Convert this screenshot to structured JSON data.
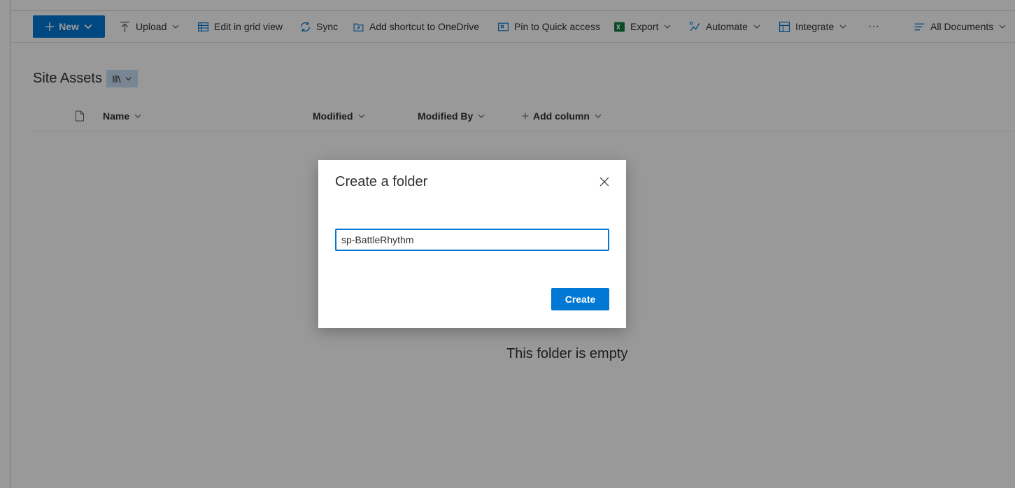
{
  "toolbar": {
    "new_label": "New",
    "upload_label": "Upload",
    "grid_label": "Edit in grid view",
    "sync_label": "Sync",
    "shortcut_label": "Add shortcut to OneDrive",
    "pin_label": "Pin to Quick access",
    "export_label": "Export",
    "automate_label": "Automate",
    "integrate_label": "Integrate",
    "more_label": "···",
    "view_label": "All Documents"
  },
  "library": {
    "title": "Site Assets",
    "columns": [
      "Name",
      "Modified",
      "Modified By",
      "Add column"
    ],
    "empty_message": "This folder is empty"
  },
  "dialog": {
    "title": "Create a folder",
    "input_value": "sp-BattleRhythm",
    "create_label": "Create"
  },
  "colors": {
    "accent": "#0078d4",
    "overlay": "rgba(0,0,0,0.4)",
    "excel_green": "#107c41"
  },
  "icons": {
    "new": "plus-icon",
    "upload": "upload-arrow-icon",
    "grid": "grid-icon",
    "sync": "sync-icon",
    "shortcut": "shortcut-icon",
    "pin": "pin-icon",
    "export": "excel-icon",
    "automate": "flow-icon",
    "integrate": "integrate-icon",
    "view": "lines-icon",
    "file_column": "document-icon",
    "close": "close-icon"
  }
}
